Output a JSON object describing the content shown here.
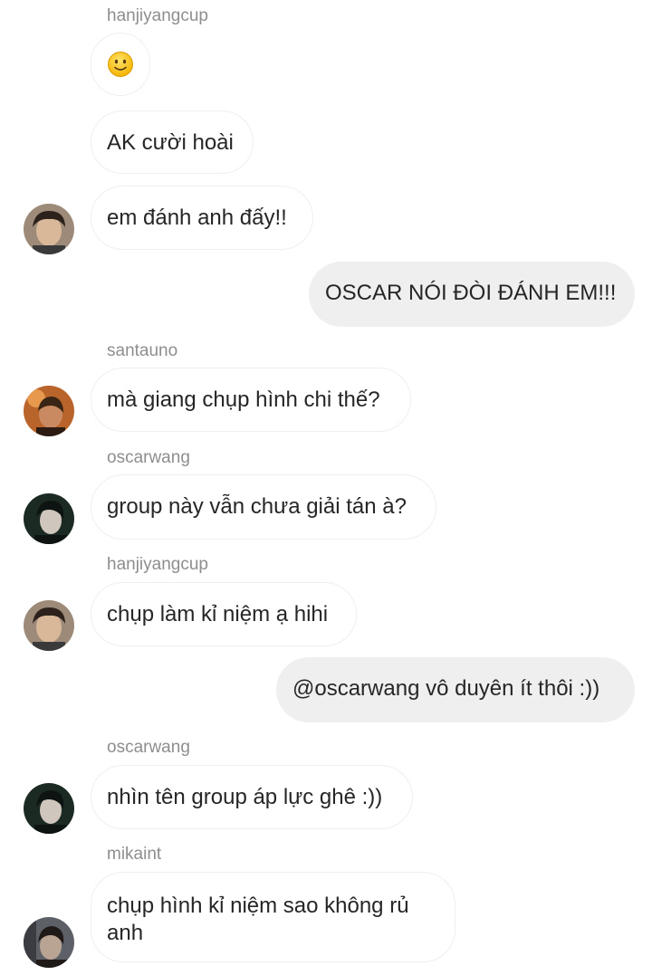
{
  "messages": [
    {
      "sender": "hanjiyangcup"
    },
    {
      "text": "AK cười hoài"
    },
    {
      "text": "em đánh anh đấy!!"
    },
    {
      "text": "OSCAR NÓI ĐÒI ĐÁNH EM!!!"
    },
    {
      "sender": "santauno",
      "text": "mà giang chụp hình chi thế?"
    },
    {
      "sender": "oscarwang",
      "text": "group này vẫn chưa giải tán à?"
    },
    {
      "sender": "hanjiyangcup",
      "text": "chụp làm kỉ niệm ạ hihi"
    },
    {
      "text": "@oscarwang vô duyên ít thôi :))"
    },
    {
      "sender": "oscarwang",
      "text": "nhìn tên group áp lực ghê :))"
    },
    {
      "sender": "mikaint",
      "text": "chụp hình kỉ niệm sao không rủ anh"
    }
  ],
  "emoji_icon": "slightly-smiling-face-icon",
  "colors": {
    "incoming_bubble_bg": "#ffffff",
    "incoming_bubble_border": "#efefef",
    "outgoing_bubble_bg": "#efefef",
    "sender_text": "#8e8e8e",
    "message_text": "#262626"
  }
}
